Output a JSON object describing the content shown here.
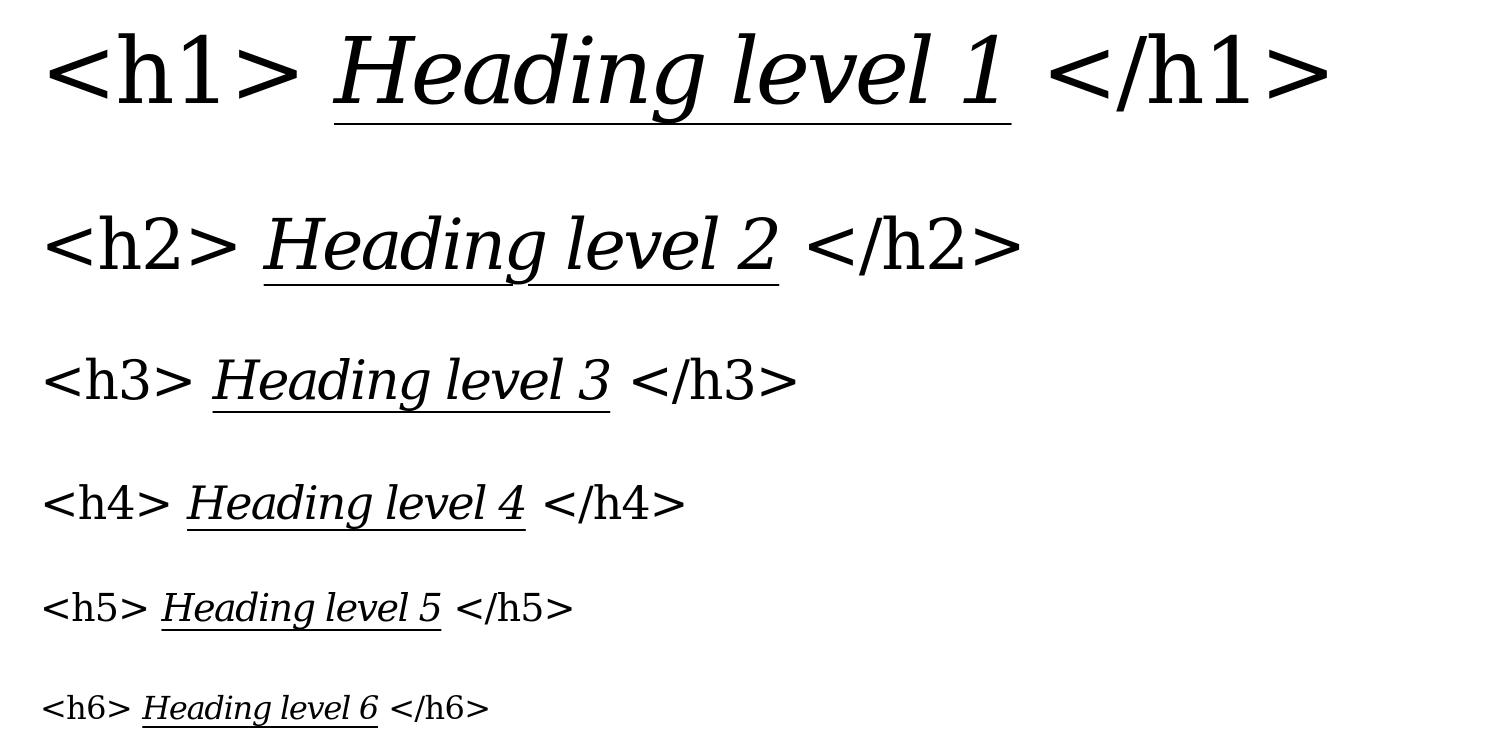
{
  "headings": [
    {
      "open_tag": "<h1>",
      "text": "Heading level 1",
      "close_tag": "</h1>"
    },
    {
      "open_tag": "<h2>",
      "text": "Heading level 2",
      "close_tag": "</h2>"
    },
    {
      "open_tag": "<h3>",
      "text": "Heading level 3",
      "close_tag": "</h3>"
    },
    {
      "open_tag": "<h4>",
      "text": "Heading level 4",
      "close_tag": "</h4>"
    },
    {
      "open_tag": "<h5>",
      "text": "Heading level 5",
      "close_tag": "</h5>"
    },
    {
      "open_tag": "<h6>",
      "text": "Heading level 6",
      "close_tag": "</h6>"
    }
  ],
  "colors": {
    "text": "#000000",
    "background": "#ffffff"
  }
}
